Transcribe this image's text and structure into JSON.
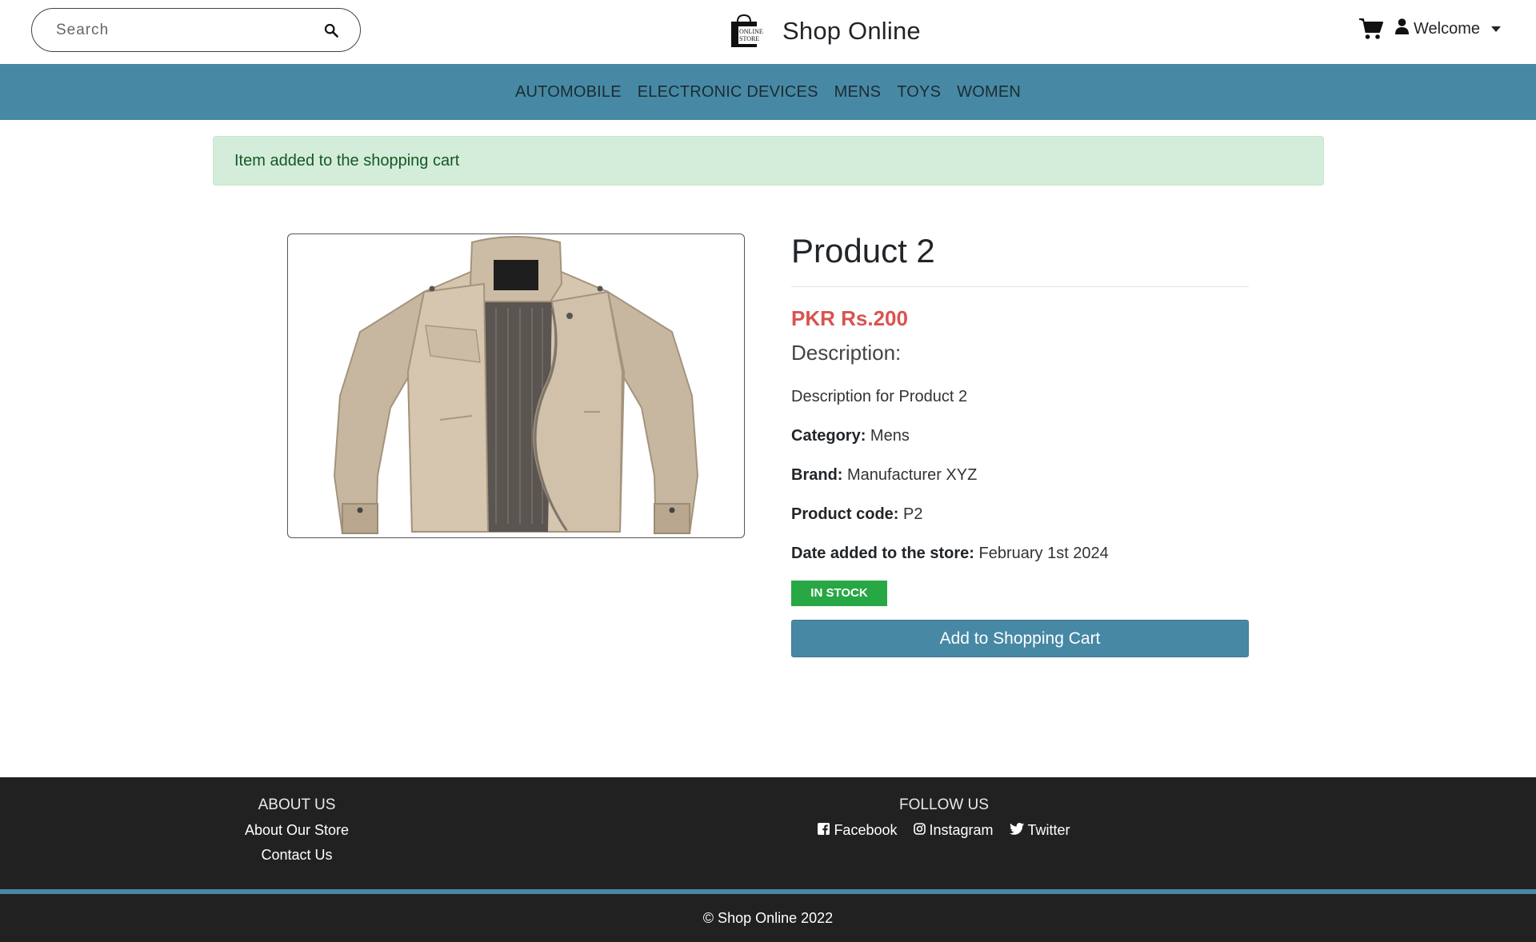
{
  "header": {
    "search_placeholder": "Search",
    "brand_title": "Shop Online",
    "logo_text_line1": "ONLINE",
    "logo_text_line2": "STORE",
    "welcome_label": "Welcome",
    "icons": [
      "search-icon",
      "cart-icon",
      "user-icon",
      "caret-down-icon"
    ]
  },
  "nav": {
    "categories": [
      "AUTOMOBILE",
      "ELECTRONIC DEVICES",
      "MENS",
      "TOYS",
      "WOMEN"
    ]
  },
  "alert": {
    "message": "Item added to the shopping cart"
  },
  "product": {
    "title": "Product 2",
    "price": "PKR Rs.200",
    "description_heading": "Description:",
    "description": "Description for Product 2",
    "category_label": "Category:",
    "category_value": "Mens",
    "brand_label": "Brand:",
    "brand_value": "Manufacturer XYZ",
    "code_label": "Product code:",
    "code_value": "P2",
    "date_label": "Date added to the store:",
    "date_value": "February 1st 2024",
    "stock_status": "IN STOCK",
    "add_to_cart_label": "Add to Shopping Cart",
    "image_subject": "beige-jacket"
  },
  "footer": {
    "about_heading": "ABOUT US",
    "about_links": [
      "About Our Store",
      "Contact Us"
    ],
    "follow_heading": "FOLLOW US",
    "social": [
      {
        "label": "Facebook",
        "icon": "facebook-icon"
      },
      {
        "label": "Instagram",
        "icon": "instagram-icon"
      },
      {
        "label": "Twitter",
        "icon": "twitter-icon"
      }
    ],
    "copyright": "© Shop Online 2022"
  },
  "colors": {
    "accent": "#4789a4",
    "price": "#d9534f",
    "success": "#28a745",
    "alert_bg": "#d4edda",
    "footer_bg": "#212121"
  }
}
